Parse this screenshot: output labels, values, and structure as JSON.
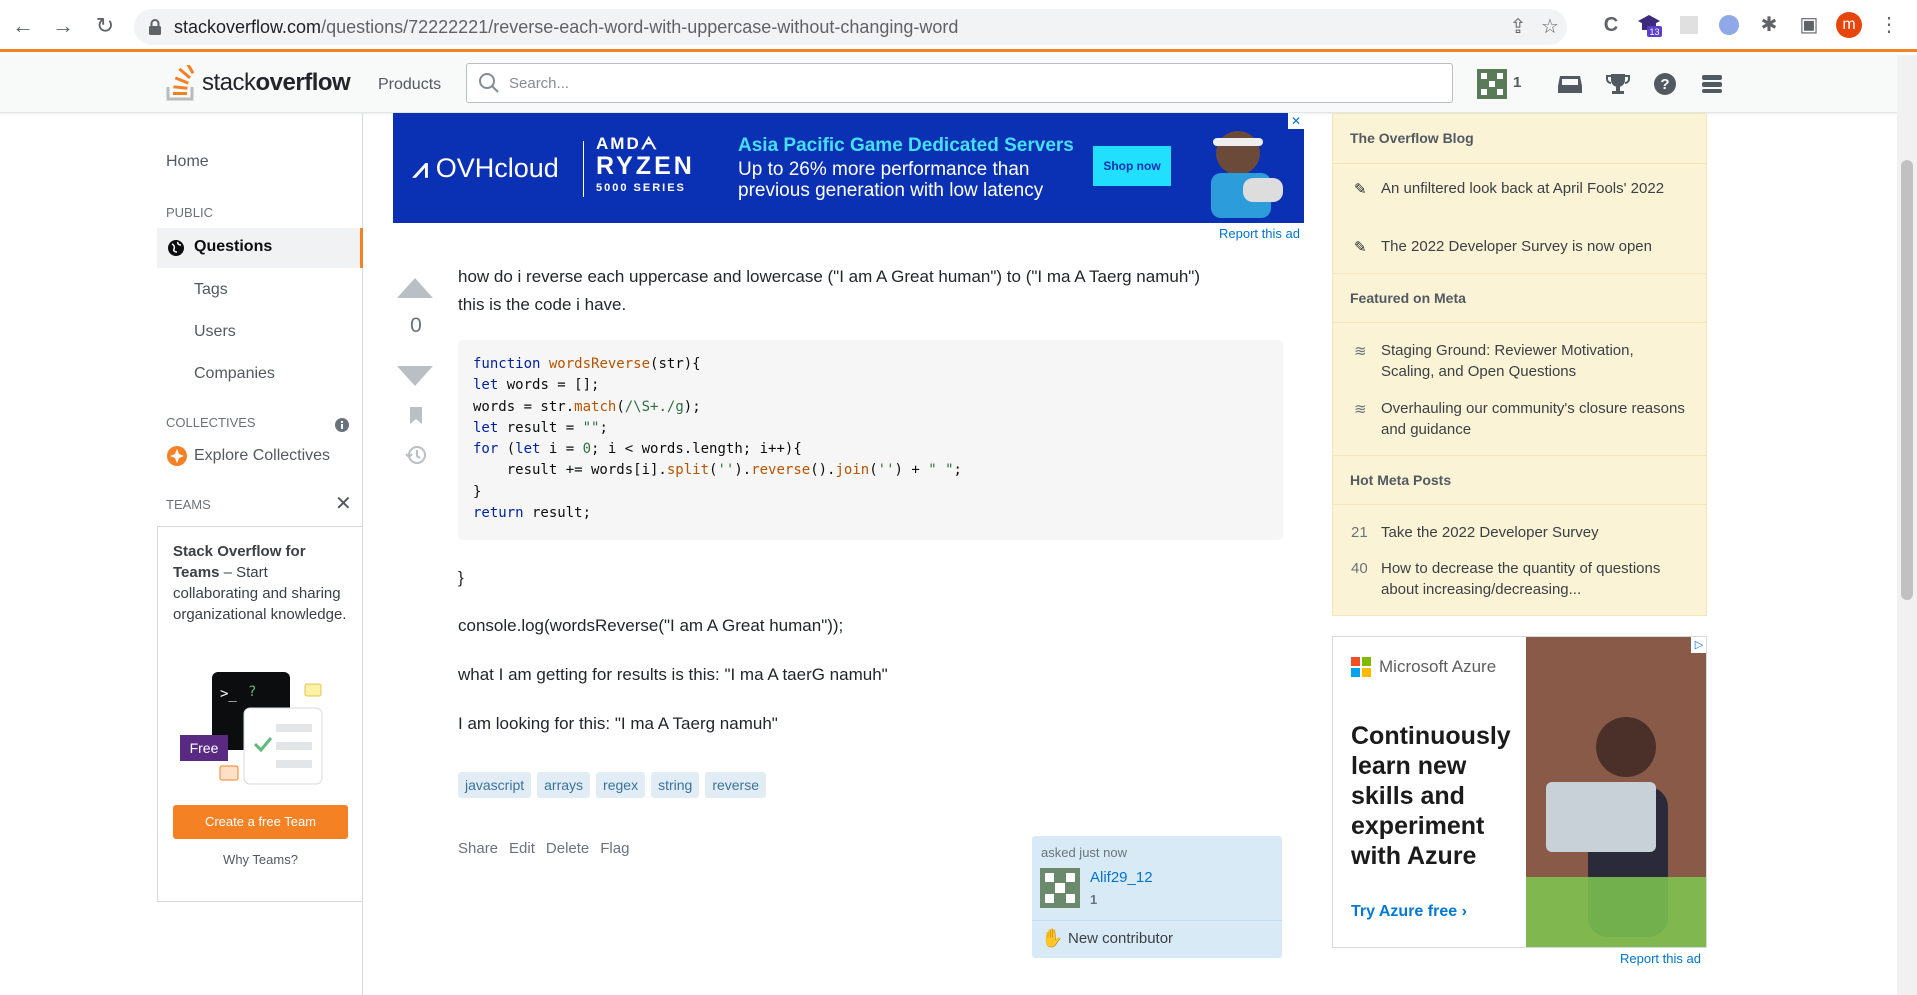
{
  "browser": {
    "url_host": "stackoverflow.com",
    "url_path": "/questions/72222221/reverse-each-word-with-uppercase-without-changing-word",
    "profile_initial": "m",
    "ext_badge": "13",
    "accent_color": "#f48225"
  },
  "header": {
    "logo_left": "stack",
    "logo_right": "overflow",
    "products": "Products",
    "search_placeholder": "Search...",
    "rep": "1"
  },
  "leftnav": {
    "home": "Home",
    "public": "PUBLIC",
    "questions": "Questions",
    "tags": "Tags",
    "users": "Users",
    "companies": "Companies",
    "collectives": "COLLECTIVES",
    "explore": "Explore Collectives",
    "teams": "TEAMS",
    "teams_title": "Stack Overflow for Teams",
    "teams_desc": " – Start collaborating and sharing organizational knowledge.",
    "free": "Free",
    "create_team": "Create a free Team",
    "why_teams": "Why Teams?"
  },
  "ad_top": {
    "brand": "OVHcloud",
    "amd1": "AMDᗅ",
    "amd2": "RYZEN",
    "amd3": "5000 SERIES",
    "headline": "Asia Pacific Game Dedicated Servers",
    "sub1": "Up to 26% more performance than",
    "sub2": "previous generation with low latency",
    "cta": "Shop now",
    "report": "Report this ad"
  },
  "question": {
    "votes": "0",
    "line1": "how do i reverse each uppercase and lowercase (\"I am A Great human\") to (\"I ma A Taerg namuh\")",
    "line2": "this is the code i have.",
    "code": [
      "function wordsReverse(str){",
      "let words = [];",
      "words = str.match(/\\S+./g);",
      "let result = \"\";",
      "for (let i = 0; i < words.length; i++){",
      "    result += words[i].split('').reverse().join('') + \" \";",
      "}",
      "return result;"
    ],
    "brace": "}",
    "console": "console.log(wordsReverse(\"I am A Great human\"));",
    "getting": "what I am getting for results is this: \"I ma A taerG namuh\"",
    "looking": "I am looking for this: \"I ma A Taerg namuh\"",
    "tags": [
      "javascript",
      "arrays",
      "regex",
      "string",
      "reverse"
    ],
    "actions": [
      "Share",
      "Edit",
      "Delete",
      "Flag"
    ],
    "asked": "asked just now",
    "user": "Alif29_12",
    "user_rep": "1",
    "new_contributor": "New contributor"
  },
  "sidebar": {
    "blog_head": "The Overflow Blog",
    "blog": [
      "An unfiltered look back at April Fools' 2022",
      "The 2022 Developer Survey is now open"
    ],
    "meta_head": "Featured on Meta",
    "meta": [
      "Staging Ground: Reviewer Motivation, Scaling, and Open Questions",
      "Overhauling our community's closure reasons and guidance"
    ],
    "hot_head": "Hot Meta Posts",
    "hot": [
      {
        "num": "21",
        "title": "Take the 2022 Developer Survey"
      },
      {
        "num": "40",
        "title": "How to decrease the quantity of questions about increasing/decreasing..."
      }
    ],
    "ad_brand": "Microsoft Azure",
    "ad_headline": "Continuously learn new skills and experiment with Azure",
    "ad_cta": "Try Azure free ›",
    "ad_report": "Report this ad"
  }
}
